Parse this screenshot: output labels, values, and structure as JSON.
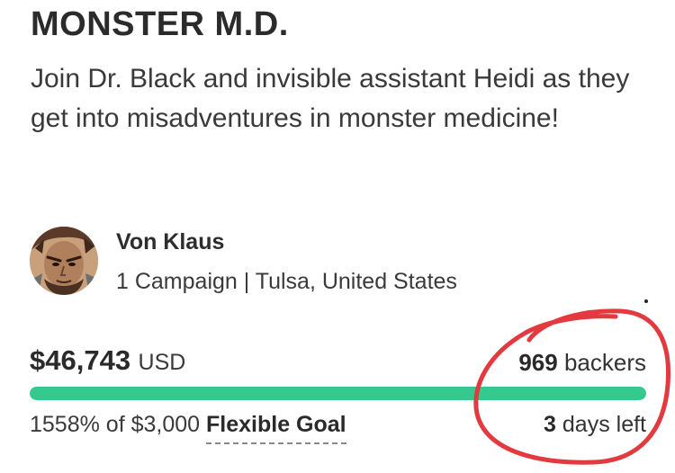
{
  "campaign": {
    "title": "MONSTER M.D.",
    "tagline": "Join Dr. Black and invisible assistant Heidi as they get into misadventures in monster medicine!"
  },
  "creator": {
    "name": "Von Klaus",
    "meta": "1 Campaign | Tulsa, United States",
    "avatar_icon": "avatar-portrait-icon"
  },
  "funding": {
    "amount": "$46,743",
    "currency": "USD",
    "backers_count": "969",
    "backers_label": "backers",
    "percent_text": "1558% of $3,000",
    "goal_type": "Flexible Goal",
    "days_count": "3",
    "days_label": "days left",
    "progress_fraction": 1.0
  },
  "colors": {
    "progress": "#34c98e",
    "annotation": "#e23a3f"
  }
}
